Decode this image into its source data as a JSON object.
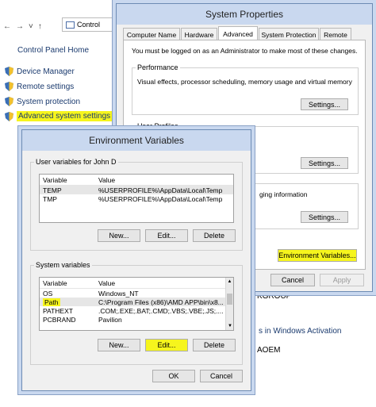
{
  "control_panel": {
    "address": "Control",
    "home_link": "Control Panel Home",
    "links": [
      "Device Manager",
      "Remote settings",
      "System protection",
      "Advanced system settings"
    ],
    "workgroup_fragment": "KGROUP",
    "activation_fragment": "s in Windows Activation",
    "oem_fragment": "AOEM"
  },
  "system_properties": {
    "title": "System Properties",
    "tabs": [
      "Computer Name",
      "Hardware",
      "Advanced",
      "System Protection",
      "Remote"
    ],
    "active_tab": "Advanced",
    "admin_note": "You must be logged on as an Administrator to make most of these changes.",
    "performance": {
      "label": "Performance",
      "text": "Visual effects, processor scheduling, memory usage and virtual memory",
      "button": "Settings..."
    },
    "user_profiles": {
      "label": "User Profiles",
      "button": "Settings..."
    },
    "startup": {
      "text_fragment": "ging information",
      "button": "Settings..."
    },
    "env_button": "Environment Variables...",
    "cancel": "Cancel",
    "apply": "Apply"
  },
  "env_vars": {
    "title": "Environment Variables",
    "user_group_label": "User variables for John D",
    "columns": [
      "Variable",
      "Value"
    ],
    "user_rows": [
      {
        "var": "TEMP",
        "value": "%USERPROFILE%\\AppData\\Local\\Temp"
      },
      {
        "var": "TMP",
        "value": "%USERPROFILE%\\AppData\\Local\\Temp"
      }
    ],
    "user_buttons": [
      "New...",
      "Edit...",
      "Delete"
    ],
    "system_group_label": "System variables",
    "system_rows": [
      {
        "var": "OS",
        "value": "Windows_NT"
      },
      {
        "var": "Path",
        "value": "C:\\Program Files (x86)\\AMD APP\\bin\\x8..."
      },
      {
        "var": "PATHEXT",
        "value": ".COM;.EXE;.BAT;.CMD;.VBS;.VBE;.JS;...."
      },
      {
        "var": "PCBRAND",
        "value": "Pavilion"
      }
    ],
    "system_buttons": [
      "New...",
      "Edit...",
      "Delete"
    ],
    "ok": "OK",
    "cancel": "Cancel"
  },
  "colors": {
    "highlight": "#f6f51d",
    "title_bar": "#c9d8ef"
  }
}
